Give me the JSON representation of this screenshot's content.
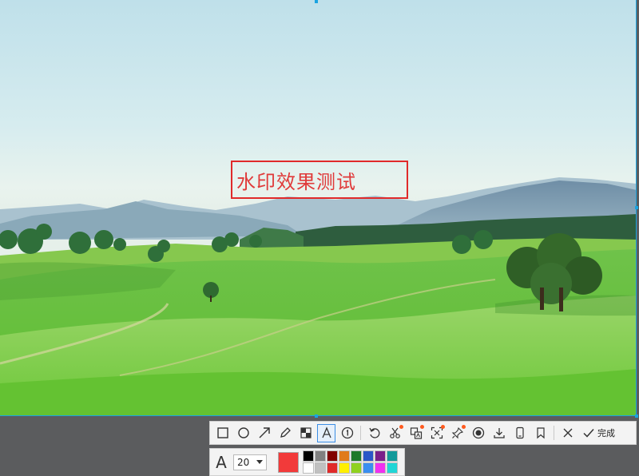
{
  "capture": {
    "watermark_text": "水印效果测试"
  },
  "toolbar": {
    "tools": [
      {
        "icon": "rectangle-icon",
        "name": "tool-rectangle"
      },
      {
        "icon": "ellipse-icon",
        "name": "tool-ellipse"
      },
      {
        "icon": "arrow-icon",
        "name": "tool-arrow"
      },
      {
        "icon": "pencil-icon",
        "name": "tool-pencil"
      },
      {
        "icon": "mosaic-icon",
        "name": "tool-mosaic"
      },
      {
        "icon": "text-icon",
        "name": "tool-text",
        "active": true
      },
      {
        "icon": "number-icon",
        "name": "tool-number"
      }
    ],
    "actions": [
      {
        "icon": "undo-icon",
        "name": "undo-button"
      },
      {
        "icon": "scissors-icon",
        "name": "cut-button",
        "badge": true
      },
      {
        "icon": "translate-icon",
        "name": "translate-button",
        "badge": true
      },
      {
        "icon": "scan-icon",
        "name": "ocr-button",
        "badge": true
      },
      {
        "icon": "pin-icon",
        "name": "pin-button",
        "badge": true
      },
      {
        "icon": "record-icon",
        "name": "record-button"
      },
      {
        "icon": "download-icon",
        "name": "save-button"
      },
      {
        "icon": "phone-icon",
        "name": "phone-button"
      },
      {
        "icon": "bookmark-icon",
        "name": "bookmark-button"
      }
    ],
    "done_label": "完成"
  },
  "options": {
    "font_size": "20",
    "current_color": "#f23a3a",
    "palette": [
      "#000000",
      "#808080",
      "#800000",
      "#e07b1a",
      "#1f7a2a",
      "#2a56c8",
      "#7a1f8a",
      "#139a9a",
      "#ffffff",
      "#c0c0c0",
      "#e02a2a",
      "#ffef00",
      "#8fd11f",
      "#3a8ef0",
      "#f030f0",
      "#20d6d6"
    ]
  }
}
